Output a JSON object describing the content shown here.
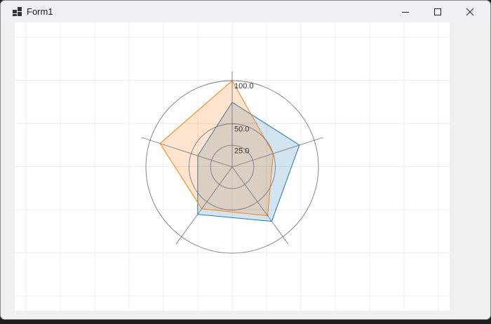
{
  "window": {
    "title": "Form1"
  },
  "chart_data": {
    "type": "radar",
    "axes_count": 5,
    "rlim": [
      0,
      100
    ],
    "rings": [
      25,
      50,
      100
    ],
    "ring_labels": [
      "25.0",
      "50.0",
      "100.0"
    ],
    "series": [
      {
        "values": [
          75,
          82,
          78,
          68,
          42
        ],
        "color": "#1f77b4",
        "fill": "rgba(31,119,180,0.2)"
      },
      {
        "values": [
          100,
          50,
          70,
          60,
          88
        ],
        "color": "#ff7f0e",
        "fill": "rgba(255,127,14,0.2)"
      }
    ]
  }
}
